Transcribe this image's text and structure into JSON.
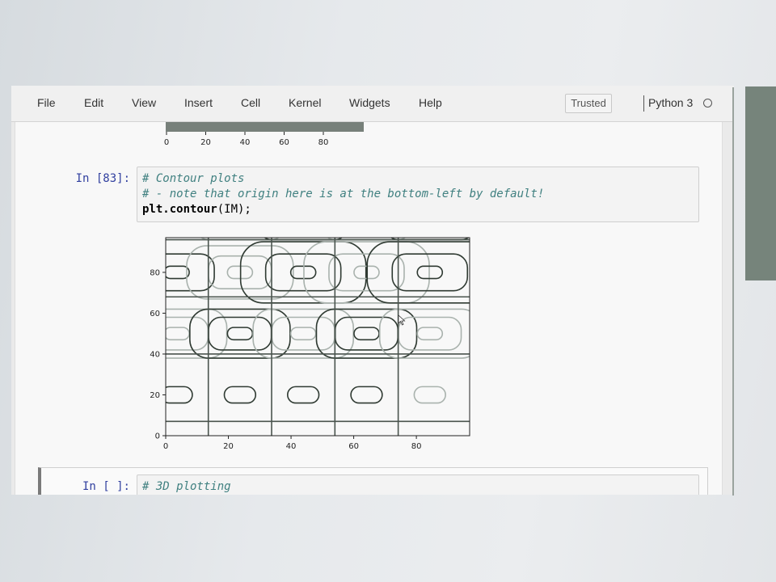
{
  "menu": {
    "file": "File",
    "edit": "Edit",
    "view": "View",
    "insert": "Insert",
    "cell": "Cell",
    "kernel": "Kernel",
    "widgets": "Widgets",
    "help": "Help"
  },
  "status": {
    "trusted": "Trusted",
    "kernel_name": "Python 3"
  },
  "previous_output": {
    "x_ticks": [
      "0",
      "20",
      "40",
      "60",
      "80"
    ]
  },
  "cells": [
    {
      "prompt": "In [83]:",
      "lines": [
        "# Contour plots",
        "# - note that origin here is at the bottom-left by default!"
      ],
      "code_func": "plt.contour",
      "code_args": "(IM);"
    },
    {
      "prompt": "In [ ]:",
      "lines": [
        "# 3D plotting"
      ]
    }
  ],
  "chart_data": {
    "type": "contour",
    "title": "",
    "xlabel": "",
    "ylabel": "",
    "xlim": [
      0,
      97
    ],
    "ylim": [
      0,
      97
    ],
    "x_ticks": [
      0,
      20,
      40,
      60,
      80
    ],
    "y_ticks": [
      0,
      20,
      40,
      60,
      80
    ],
    "grid_lines_x": [
      13.6,
      33.8,
      54.0,
      74.2
    ],
    "grid_lines_y": [
      7,
      40,
      68,
      96
    ],
    "colors": {
      "dark": "#2f3a32",
      "light": "#a9b2ad",
      "grid": "#4a544e"
    },
    "contour_groups": [
      {
        "cx": 3.5,
        "cy": 80,
        "rx": [
          4,
          12
        ],
        "ry": [
          3,
          9
        ],
        "tone": "dark"
      },
      {
        "cx": 23.7,
        "cy": 80,
        "rx": [
          4,
          10,
          17
        ],
        "ry": [
          3,
          8,
          13
        ],
        "tone": "light"
      },
      {
        "cx": 43.9,
        "cy": 80,
        "rx": [
          4,
          12,
          20
        ],
        "ry": [
          3,
          9,
          15
        ],
        "tone": "dark"
      },
      {
        "cx": 64.1,
        "cy": 80,
        "rx": [
          4,
          12,
          20
        ],
        "ry": [
          3,
          9,
          15
        ],
        "tone": "light"
      },
      {
        "cx": 3.5,
        "cy": 50,
        "rx": [
          4,
          10,
          16
        ],
        "ry": [
          3,
          8,
          12
        ],
        "tone": "light"
      },
      {
        "cx": 23.7,
        "cy": 50,
        "rx": [
          4,
          10,
          16
        ],
        "ry": [
          3,
          8,
          12
        ],
        "tone": "dark"
      },
      {
        "cx": 43.9,
        "cy": 50,
        "rx": [
          4,
          10,
          16
        ],
        "ry": [
          3,
          8,
          12
        ],
        "tone": "light"
      },
      {
        "cx": 64.1,
        "cy": 50,
        "rx": [
          4,
          10,
          16
        ],
        "ry": [
          3,
          8,
          12
        ],
        "tone": "dark"
      },
      {
        "cx": 3.5,
        "cy": 20,
        "rx": [
          5
        ],
        "ry": [
          4
        ],
        "tone": "dark"
      },
      {
        "cx": 23.7,
        "cy": 20,
        "rx": [
          5
        ],
        "ry": [
          4
        ],
        "tone": "dark"
      },
      {
        "cx": 43.9,
        "cy": 20,
        "rx": [
          5
        ],
        "ry": [
          4
        ],
        "tone": "dark"
      },
      {
        "cx": 64.1,
        "cy": 20,
        "rx": [
          5
        ],
        "ry": [
          4
        ],
        "tone": "dark"
      },
      {
        "cx": 23.7,
        "cy": 104,
        "rx": [
          8,
          14
        ],
        "ry": [
          4,
          8
        ],
        "tone": "light"
      },
      {
        "cx": 43.9,
        "cy": 104,
        "rx": [
          8,
          14
        ],
        "ry": [
          4,
          8
        ],
        "tone": "dark"
      },
      {
        "cx": 64.1,
        "cy": 104,
        "rx": [
          8,
          14
        ],
        "ry": [
          4,
          8
        ],
        "tone": "light"
      },
      {
        "cx": 84.3,
        "cy": 104,
        "rx": [
          8,
          14
        ],
        "ry": [
          4,
          8
        ],
        "tone": "dark"
      },
      {
        "cx": 84.3,
        "cy": 80,
        "rx": [
          4,
          12,
          20
        ],
        "ry": [
          3,
          9,
          15
        ],
        "tone": "dark"
      },
      {
        "cx": 84.3,
        "cy": 50,
        "rx": [
          4,
          10,
          16
        ],
        "ry": [
          3,
          8,
          12
        ],
        "tone": "light"
      },
      {
        "cx": 84.3,
        "cy": 20,
        "rx": [
          5
        ],
        "ry": [
          4
        ],
        "tone": "light"
      }
    ]
  }
}
